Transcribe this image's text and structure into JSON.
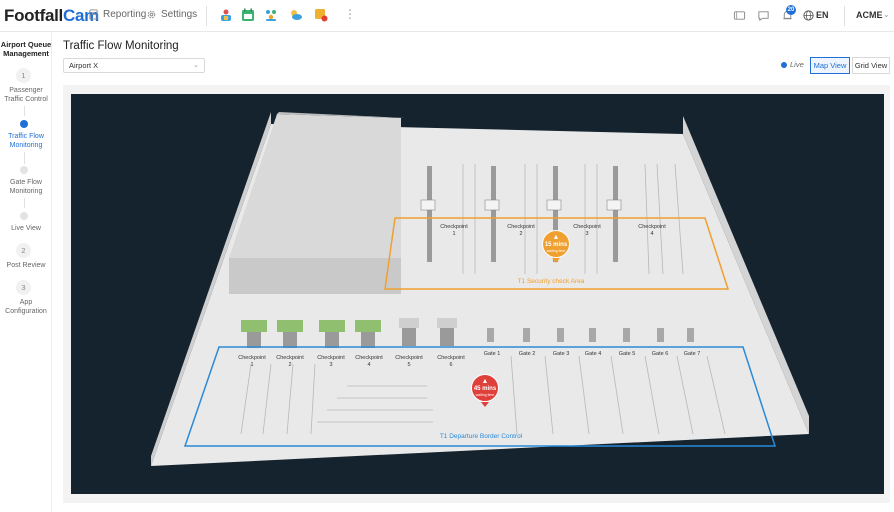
{
  "brand": {
    "part1": "Footfall",
    "part2": "Cam"
  },
  "nav": {
    "reporting": "Reporting",
    "settings": "Settings",
    "more": "⋮"
  },
  "header_right": {
    "notifications_count": "20",
    "language": "EN",
    "account": "ACME"
  },
  "sidebar": {
    "title": "Airport Queue Management",
    "steps": [
      {
        "num": "1",
        "label": "Passenger Traffic Control"
      },
      {
        "label": "Traffic Flow Monitoring",
        "active": true
      },
      {
        "label": "Gate Flow Monitoring"
      },
      {
        "label": "Live View"
      },
      {
        "num": "2",
        "label": "Post Review"
      },
      {
        "num": "3",
        "label": "App Configuration"
      }
    ]
  },
  "page": {
    "title": "Traffic Flow Monitoring",
    "info_icon": "i"
  },
  "site_select": {
    "value": "Airport X"
  },
  "view": {
    "live_label": "Live",
    "map_view": "Map View",
    "grid_view": "Grid View"
  },
  "map": {
    "security_zone": {
      "name": "T1 Security check Area",
      "color": "#f0a030",
      "checkpoints": [
        {
          "line1": "Checkpoint",
          "line2": "1"
        },
        {
          "line1": "Checkpoint",
          "line2": "2"
        },
        {
          "line1": "Checkpoint",
          "line2": "3"
        },
        {
          "line1": "Checkpoint",
          "line2": "4"
        }
      ],
      "wait": {
        "value": "15 mins",
        "sub": "waiting time"
      }
    },
    "border_zone": {
      "name": "T1 Departure Border Control",
      "color": "#2a8ad8",
      "checkpoints": [
        {
          "line1": "Checkpoint",
          "line2": "1"
        },
        {
          "line1": "Checkpoint",
          "line2": "2"
        },
        {
          "line1": "Checkpoint",
          "line2": "3"
        },
        {
          "line1": "Checkpoint",
          "line2": "4"
        },
        {
          "line1": "Checkpoint",
          "line2": "5"
        },
        {
          "line1": "Checkpoint",
          "line2": "6"
        }
      ],
      "gates": [
        "Gate 1",
        "Gate 2",
        "Gate 3",
        "Gate 4",
        "Gate 5",
        "Gate 6",
        "Gate 7"
      ],
      "wait": {
        "value": "45 mins",
        "sub": "waiting time"
      }
    }
  },
  "icons": {
    "reporting": "document-icon",
    "settings": "gear-icon",
    "apps": [
      "people-app-icon",
      "calendar-app-icon",
      "group-app-icon",
      "weather-app-icon",
      "alert-app-icon"
    ],
    "right": [
      "tablet-icon",
      "chat-icon",
      "bell-icon",
      "globe-icon",
      "chevron-down-icon"
    ]
  },
  "colors": {
    "brand_blue": "#1f6fd6",
    "map_background": "#14232e",
    "warning_orange": "#f0a030",
    "alert_red": "#e0403a"
  }
}
